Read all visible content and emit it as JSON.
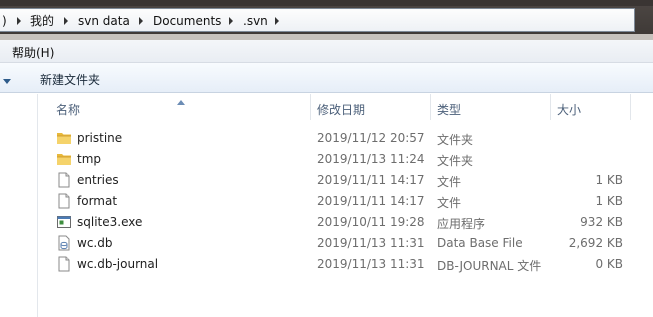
{
  "breadcrumb": {
    "items": [
      ")",
      "我的",
      "svn data",
      "Documents",
      ".svn"
    ]
  },
  "menu": {
    "help": "帮助(H)"
  },
  "toolbar": {
    "new_folder": "新建文件夹"
  },
  "columns": {
    "name": "名称",
    "modified": "修改日期",
    "type": "类型",
    "size": "大小"
  },
  "files": [
    {
      "name": "pristine",
      "modified": "2019/11/12 20:57",
      "type": "文件夹",
      "size": "",
      "icon": "folder-icon"
    },
    {
      "name": "tmp",
      "modified": "2019/11/13 11:24",
      "type": "文件夹",
      "size": "",
      "icon": "folder-icon"
    },
    {
      "name": "entries",
      "modified": "2019/11/11 14:17",
      "type": "文件",
      "size": "1 KB",
      "icon": "file-icon"
    },
    {
      "name": "format",
      "modified": "2019/11/11 14:17",
      "type": "文件",
      "size": "1 KB",
      "icon": "file-icon"
    },
    {
      "name": "sqlite3.exe",
      "modified": "2019/10/11 19:28",
      "type": "应用程序",
      "size": "932 KB",
      "icon": "exe-icon"
    },
    {
      "name": "wc.db",
      "modified": "2019/11/13 11:31",
      "type": "Data Base File",
      "size": "2,692 KB",
      "icon": "db-file-icon"
    },
    {
      "name": "wc.db-journal",
      "modified": "2019/11/13 11:31",
      "type": "DB-JOURNAL 文件",
      "size": "0 KB",
      "icon": "file-icon"
    }
  ]
}
